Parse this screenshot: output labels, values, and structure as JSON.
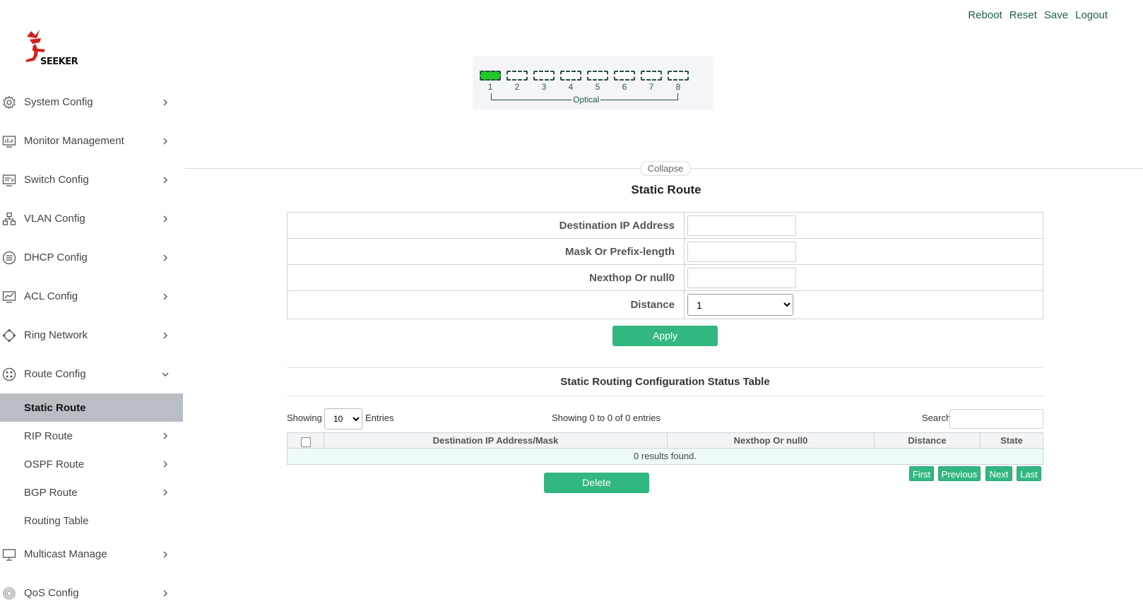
{
  "header": {
    "links": [
      "Reboot",
      "Reset",
      "Save",
      "Logout"
    ]
  },
  "logo": {
    "brand": "SEEKER"
  },
  "sidebar": {
    "items": [
      {
        "label": "System Config",
        "icon": "gear-icon"
      },
      {
        "label": "Monitor Management",
        "icon": "monitor-chart-icon"
      },
      {
        "label": "Switch Config",
        "icon": "switch-icon"
      },
      {
        "label": "VLAN Config",
        "icon": "network-tree-icon"
      },
      {
        "label": "DHCP Config",
        "icon": "list-circle-icon"
      },
      {
        "label": "ACL Config",
        "icon": "chart-screen-icon"
      },
      {
        "label": "Ring Network",
        "icon": "ring-diamond-icon"
      },
      {
        "label": "Route Config",
        "icon": "route-circle-icon"
      }
    ],
    "route_sub": [
      {
        "label": "Static Route"
      },
      {
        "label": "RIP Route"
      },
      {
        "label": "OSPF Route"
      },
      {
        "label": "BGP Route"
      },
      {
        "label": "Routing Table"
      }
    ],
    "items_after": [
      {
        "label": "Multicast Manage",
        "icon": "desktop-icon"
      },
      {
        "label": "QoS Config",
        "icon": "fingerprint-icon"
      }
    ]
  },
  "ports": {
    "numbers": [
      "1",
      "2",
      "3",
      "4",
      "5",
      "6",
      "7",
      "8"
    ],
    "group_label": "Optical",
    "up_color": "#23c82a"
  },
  "collapse_label": "Collapse",
  "page_title": "Static Route",
  "form": {
    "dest_label": "Destination IP Address",
    "dest_value": "",
    "mask_label": "Mask Or Prefix-length",
    "mask_value": "",
    "nexthop_label": "Nexthop Or null0",
    "nexthop_value": "",
    "distance_label": "Distance",
    "distance_value": "1"
  },
  "apply_label": "Apply",
  "status_table": {
    "title": "Static Routing Configuration Status Table",
    "showing_label": "Showing",
    "entries_value": "10",
    "entries_label": "Entries",
    "info": "Showing 0 to 0 of 0 entries",
    "search_label": "Search",
    "columns": [
      "Destination IP Address/Mask",
      "Nexthop Or null0",
      "Distance",
      "State"
    ],
    "empty_text": "0 results found."
  },
  "pagination": [
    "First",
    "Previous",
    "Next",
    "Last"
  ],
  "delete_label": "Delete",
  "colors": {
    "accent": "#32b780",
    "link": "#1f5e4a",
    "active_menu": "#b9bec4"
  }
}
